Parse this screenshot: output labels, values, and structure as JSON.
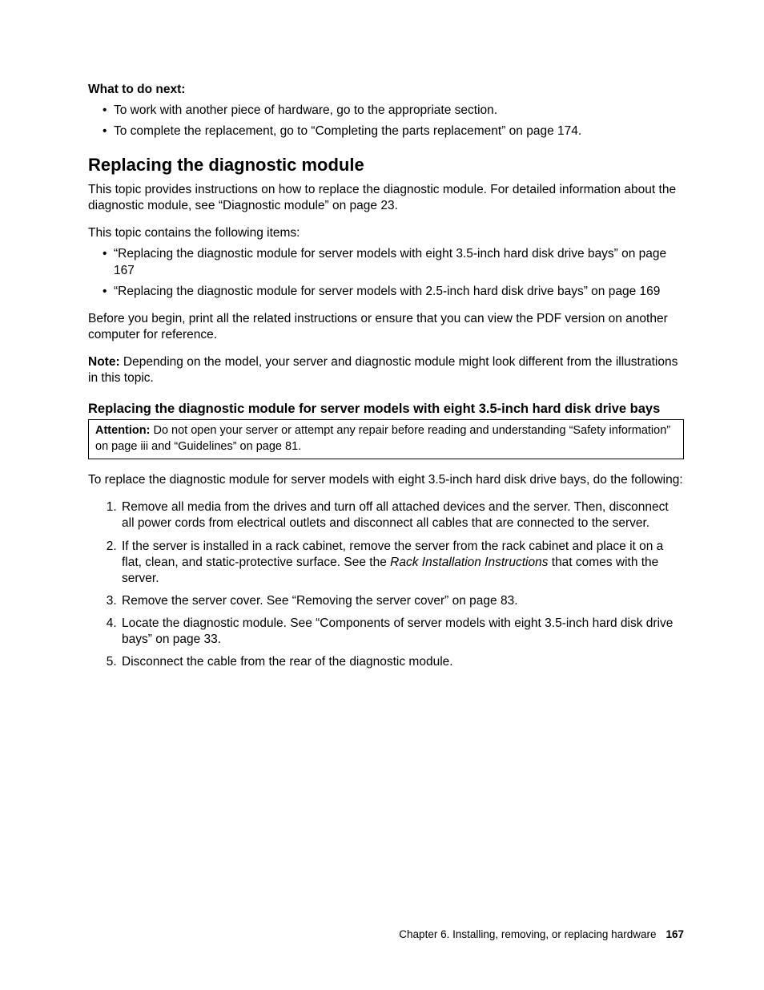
{
  "intro": {
    "heading": "What to do next:",
    "bullets": [
      "To work with another piece of hardware, go to the appropriate section.",
      "To complete the replacement, go to “Completing the parts replacement” on page 174."
    ]
  },
  "section": {
    "title": "Replacing the diagnostic module",
    "para1": "This topic provides instructions on how to replace the diagnostic module. For detailed information about the diagnostic module, see “Diagnostic module” on page 23.",
    "para2": "This topic contains the following items:",
    "toc": [
      "“Replacing the diagnostic module for server models with eight 3.5-inch hard disk drive bays” on page 167",
      "“Replacing the diagnostic module for server models with 2.5-inch hard disk drive bays” on page 169"
    ],
    "para3": "Before you begin, print all the related instructions or ensure that you can view the PDF version on another computer for reference.",
    "note_label": "Note:",
    "note_text": " Depending on the model, your server and diagnostic module might look different from the illustrations in this topic."
  },
  "subsection": {
    "title": "Replacing the diagnostic module for server models with eight 3.5-inch hard disk drive bays",
    "attention_label": "Attention:",
    "attention_text": " Do not open your server or attempt any repair before reading and understanding “Safety information” on page iii and “Guidelines” on page 81.",
    "lead": "To replace the diagnostic module for server models with eight 3.5-inch hard disk drive bays, do the following:",
    "steps": [
      "Remove all media from the drives and turn off all attached devices and the server. Then, disconnect all power cords from electrical outlets and disconnect all cables that are connected to the server.",
      {
        "pre": "If the server is installed in a rack cabinet, remove the server from the rack cabinet and place it on a flat, clean, and static-protective surface. See the ",
        "em": "Rack Installation Instructions",
        "post": " that comes with the server."
      },
      "Remove the server cover. See “Removing the server cover” on page 83.",
      "Locate the diagnostic module. See “Components of server models with eight 3.5-inch hard disk drive bays” on page 33.",
      "Disconnect the cable from the rear of the diagnostic module."
    ]
  },
  "footer": {
    "chapter": "Chapter 6. Installing, removing, or replacing hardware",
    "page": "167"
  }
}
